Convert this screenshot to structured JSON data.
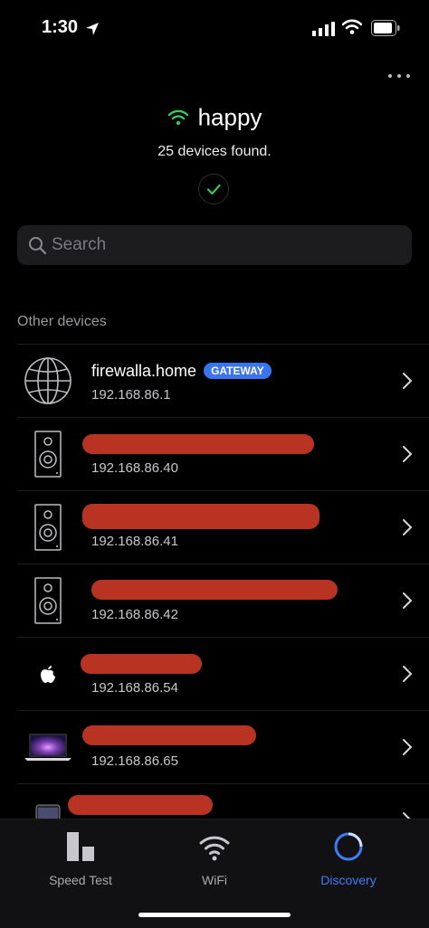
{
  "status_bar": {
    "time": "1:30"
  },
  "header": {
    "network_name": "happy",
    "devices_found": "25 devices found."
  },
  "search": {
    "placeholder": "Search"
  },
  "section": {
    "title": "Other devices"
  },
  "devices": [
    {
      "name": "firewalla.home",
      "badge": "GATEWAY",
      "ip": "192.168.86.1",
      "icon": "globe-icon"
    },
    {
      "name": "",
      "ip": "192.168.86.40",
      "icon": "speaker-icon"
    },
    {
      "name": "",
      "ip": "192.168.86.41",
      "icon": "speaker-icon"
    },
    {
      "name": "",
      "ip": "192.168.86.42",
      "icon": "speaker-icon"
    },
    {
      "name": "",
      "ip": "192.168.86.54",
      "icon": "apple-icon"
    },
    {
      "name": "",
      "ip": "192.168.86.65",
      "icon": "laptop-icon"
    },
    {
      "name": "",
      "ip": "",
      "icon": "tablet-icon"
    }
  ],
  "tabs": [
    {
      "label": "Speed Test",
      "icon": "speed-test-icon"
    },
    {
      "label": "WiFi",
      "icon": "wifi-icon"
    },
    {
      "label": "Discovery",
      "icon": "discovery-icon",
      "active": true
    }
  ],
  "colors": {
    "accent": "#3d7cf5",
    "wifi_green": "#35c85a",
    "badge": "#3b74f0",
    "redaction": "#b83322"
  }
}
